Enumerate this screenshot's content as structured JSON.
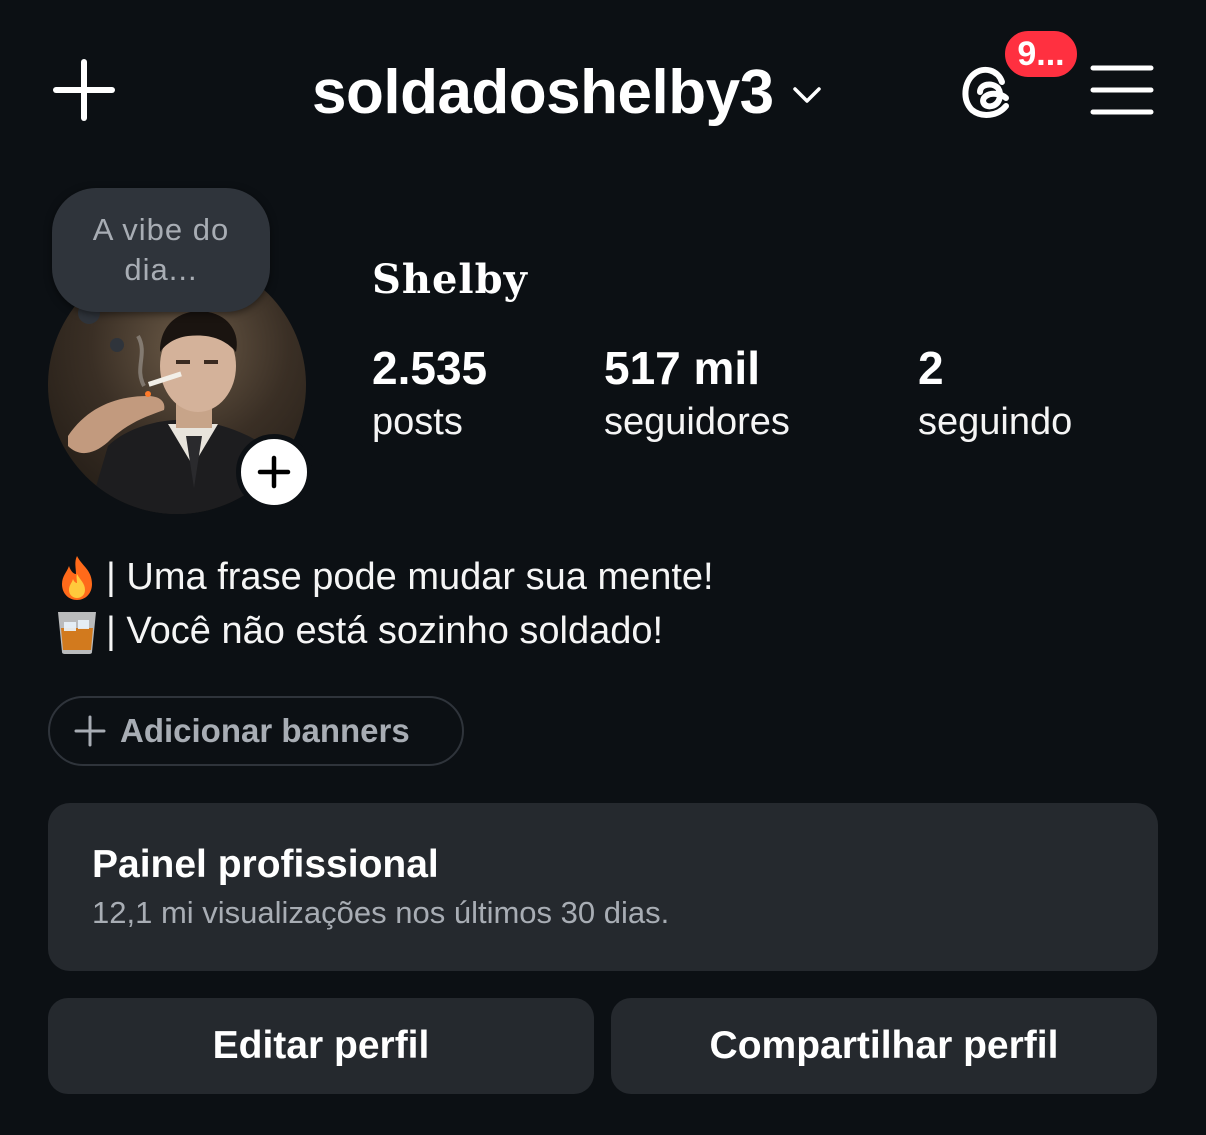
{
  "header": {
    "username": "soldadoshelby3",
    "notification_badge": "9..."
  },
  "profile": {
    "note_text": "A vibe do dia...",
    "display_name": "Shelby",
    "stats": [
      {
        "value": "2.535",
        "label": "posts"
      },
      {
        "value": "517 mil",
        "label": "seguidores"
      },
      {
        "value": "2",
        "label": "seguindo"
      }
    ],
    "bio_lines": [
      {
        "emoji": "fire-emoji",
        "text": "| Uma frase pode mudar sua mente!"
      },
      {
        "emoji": "whiskey-glass-emoji",
        "text": "| Você não está sozinho soldado!"
      }
    ]
  },
  "banners": {
    "label": "Adicionar banners"
  },
  "dashboard": {
    "title": "Painel profissional",
    "subtitle": "12,1 mi visualizações nos últimos 30 dias."
  },
  "actions": {
    "edit_label": "Editar perfil",
    "share_label": "Compartilhar perfil"
  },
  "icons": {
    "create": "plus-icon",
    "switch_account": "chevron-down-icon",
    "threads": "threads-icon",
    "menu": "hamburger-menu-icon",
    "add_story": "plus-circle-icon",
    "add_banner": "plus-icon"
  },
  "colors": {
    "background": "#0c1014",
    "surface": "#25292e",
    "badge": "#ff3040",
    "secondary_text": "#a8adb4"
  }
}
